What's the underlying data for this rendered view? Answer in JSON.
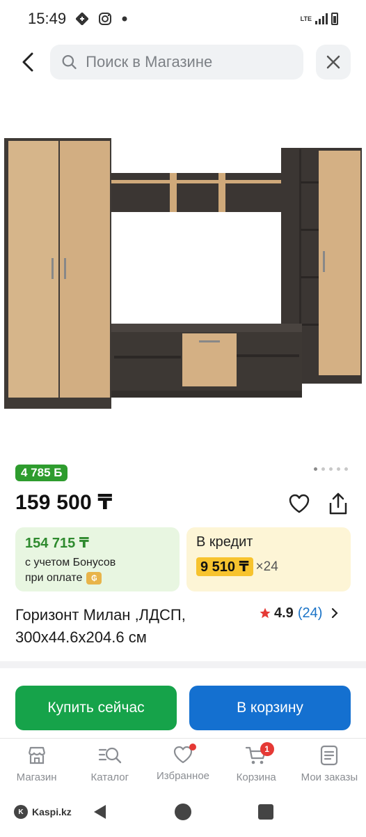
{
  "status": {
    "time": "15:49",
    "network": "LTE"
  },
  "search": {
    "placeholder": "Поиск в Магазине"
  },
  "product": {
    "bonus_badge": "4 785 Б",
    "price": "159 500 ₸",
    "title": "Горизонт Милан ,ЛДСП, 300x44.6x204.6 см",
    "rating": "4.9",
    "reviews": "(24)",
    "image_count": 5,
    "active_image": 1
  },
  "bonus_card": {
    "amount": "154 715 ₸",
    "line1": "с учетом Бонусов",
    "line2": "при оплате"
  },
  "credit_card": {
    "title": "В кредит",
    "monthly": "9 510 ₸",
    "term": "×24"
  },
  "actions": {
    "buy_now": "Купить сейчас",
    "add_to_cart": "В корзину"
  },
  "nav": {
    "items": [
      {
        "label": "Магазин",
        "icon": "shop-icon"
      },
      {
        "label": "Каталог",
        "icon": "catalog-search-icon"
      },
      {
        "label": "Избранное",
        "icon": "heart-icon"
      },
      {
        "label": "Корзина",
        "icon": "cart-icon"
      },
      {
        "label": "Мои заказы",
        "icon": "orders-icon"
      }
    ],
    "cart_count": "1"
  },
  "watermark": "Kaspi.kz",
  "colors": {
    "accent_green": "#16a34a",
    "accent_blue": "#1470d0",
    "credit_yellow": "#f7c32e",
    "badge_red": "#e53935"
  }
}
